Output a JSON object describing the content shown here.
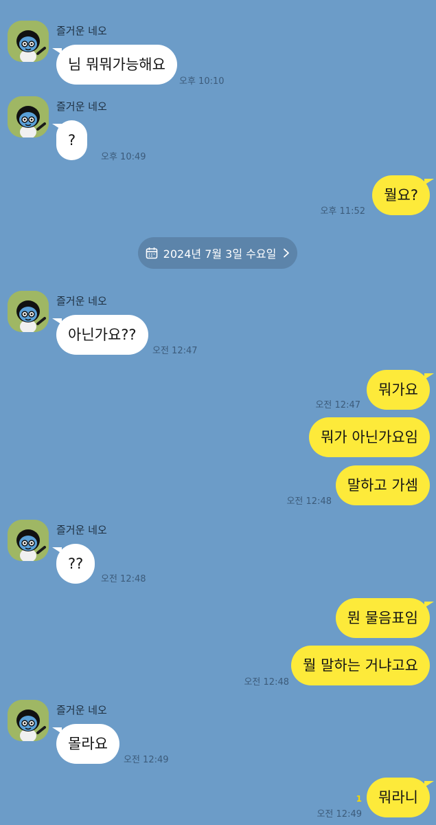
{
  "chat": {
    "sender_name": "즐거운 네오",
    "date_divider": "2024년 7월 3일 수요일",
    "messages": [
      {
        "text": "님 뭐뭐가능해요",
        "time": "오후 10:10"
      },
      {
        "text": "?",
        "time": "오후 10:49"
      },
      {
        "text": "뭘요?",
        "time": "오후 11:52"
      },
      {
        "text": "아닌가요??",
        "time": "오전 12:47"
      },
      {
        "text": "뭐가요",
        "time": "오전 12:47"
      },
      {
        "text": "뭐가 아닌가요임"
      },
      {
        "text": "말하고 가셈",
        "time": "오전 12:48"
      },
      {
        "text": "??",
        "time": "오전 12:48"
      },
      {
        "text": "뭔 물음표임"
      },
      {
        "text": "뭘 말하는 거냐고요",
        "time": "오전 12:48"
      },
      {
        "text": "몰라요",
        "time": "오전 12:49"
      },
      {
        "text": "뭐라니",
        "time": "오전 12:49",
        "unread": "1"
      }
    ]
  },
  "icons": {
    "calendar": "calendar-icon",
    "chevron": "chevron-right-icon",
    "avatar": "neo-character-avatar"
  },
  "colors": {
    "background": "#6c9cc8",
    "outgoing_bubble": "#fdea3a",
    "incoming_bubble": "#ffffff",
    "date_pill": "#5c84aa",
    "avatar_bg": "#9fb764"
  }
}
